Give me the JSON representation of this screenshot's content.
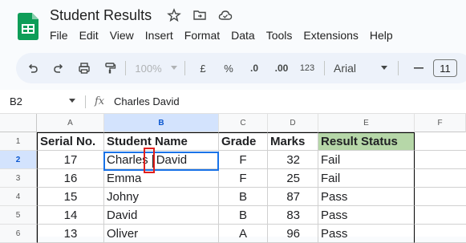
{
  "app": {
    "title": "Student Results",
    "menu": [
      "File",
      "Edit",
      "View",
      "Insert",
      "Format",
      "Data",
      "Tools",
      "Extensions",
      "Help"
    ],
    "accent": "#1a73e8",
    "logo_color": "#0f9d58"
  },
  "toolbar": {
    "zoom": "100%",
    "currency": "£",
    "percent": "%",
    "dec_decrease": ".0",
    "dec_increase": ".00",
    "more_formats": "123",
    "font": "Arial",
    "font_size": "11"
  },
  "formula_bar": {
    "cell_ref": "B2",
    "fx": "fx",
    "value": "Charles  David"
  },
  "sheet": {
    "columns": [
      "A",
      "B",
      "C",
      "D",
      "E",
      "F"
    ],
    "rows": [
      "1",
      "2",
      "3",
      "4",
      "5",
      "6"
    ],
    "header": [
      "Serial No.",
      "Student Name",
      "Grade",
      "Marks",
      "Result Status"
    ],
    "data": [
      [
        "17",
        "Charles",
        "David",
        "F",
        "32",
        "Fail"
      ],
      [
        "16",
        "Emma",
        "",
        "F",
        "25",
        "Fail"
      ],
      [
        "15",
        "Johny",
        "",
        "B",
        "87",
        "Pass"
      ],
      [
        "14",
        "David",
        "",
        "B",
        "83",
        "Pass"
      ],
      [
        "13",
        "Oliver",
        "",
        "A",
        "96",
        "Pass"
      ]
    ],
    "header_fill": "#b6d7a8"
  }
}
